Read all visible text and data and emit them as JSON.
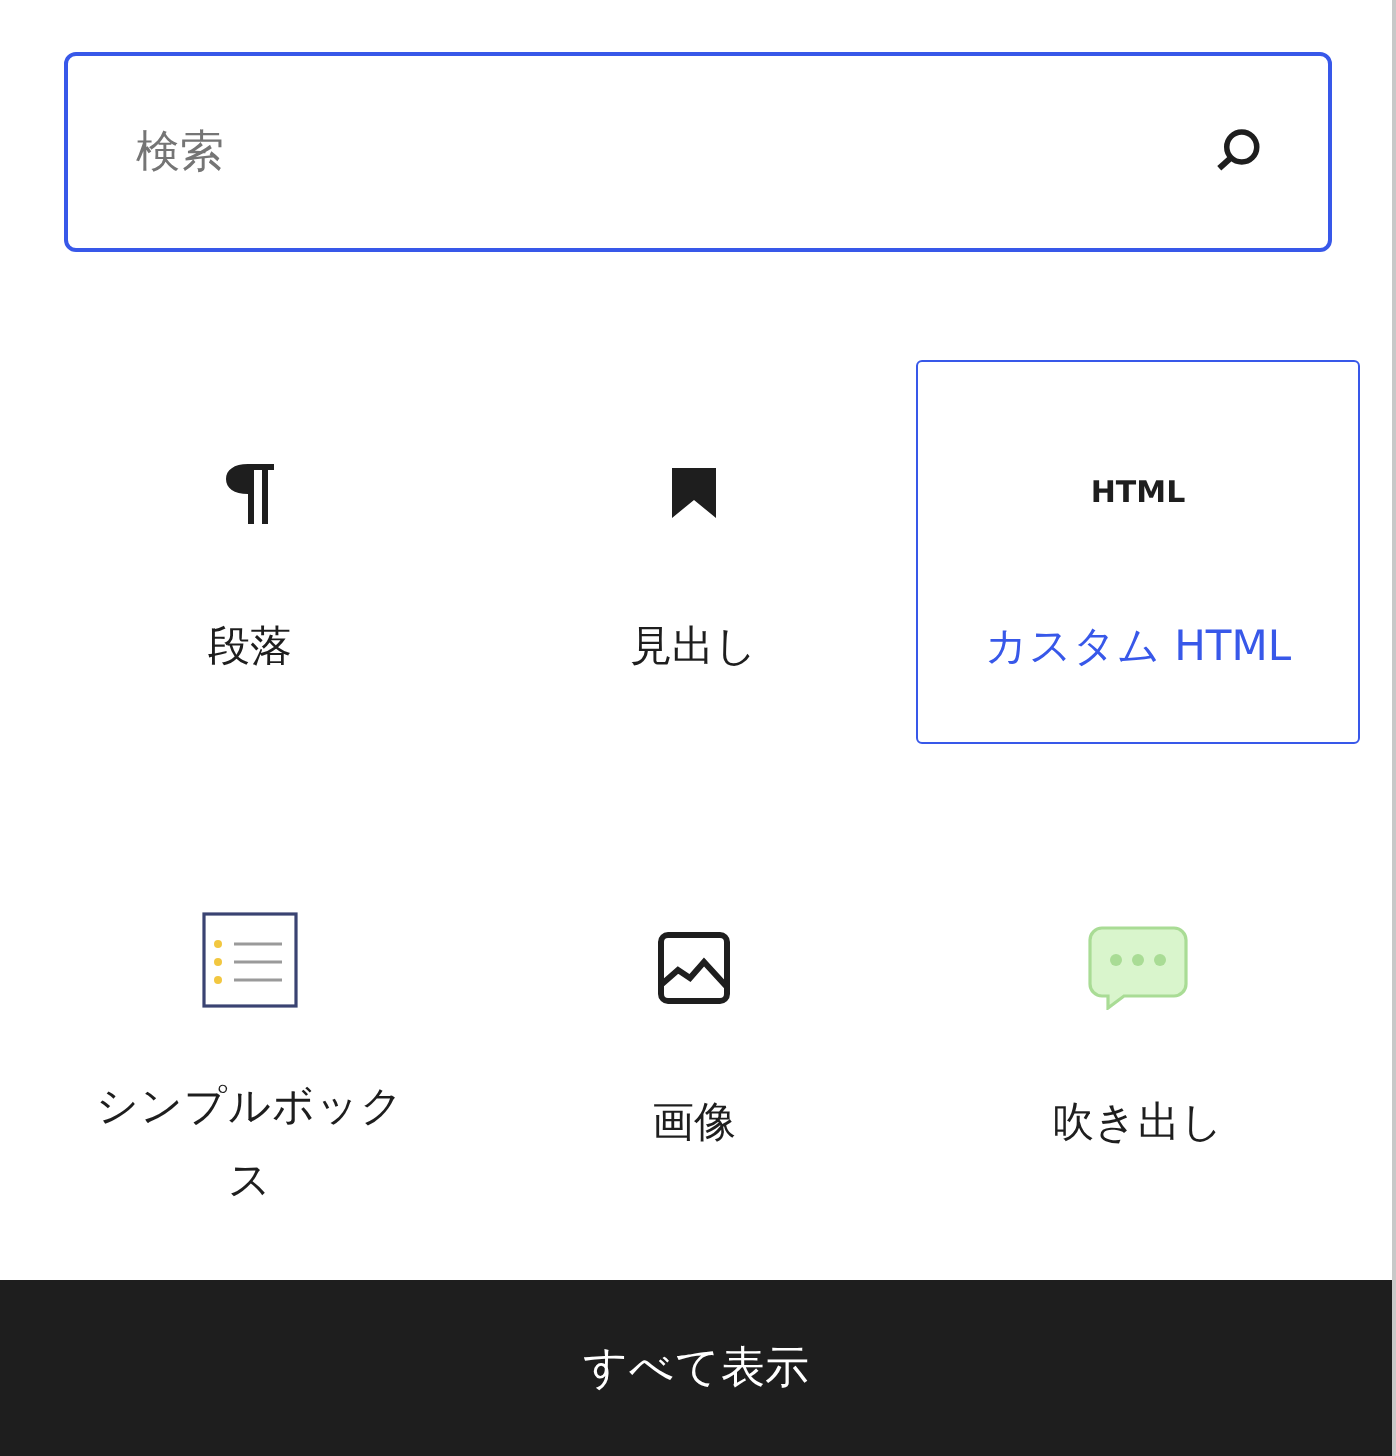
{
  "search": {
    "placeholder": "検索"
  },
  "blocks": [
    {
      "kind": "pilcrow",
      "label": "段落",
      "selected": false
    },
    {
      "kind": "bookmark",
      "label": "見出し",
      "selected": false
    },
    {
      "kind": "html",
      "icon_text": "HTML",
      "label": "カスタム HTML",
      "selected": true
    },
    {
      "kind": "list",
      "label": "シンプルボックス",
      "selected": false
    },
    {
      "kind": "image",
      "label": "画像",
      "selected": false
    },
    {
      "kind": "balloon",
      "label": "吹き出し",
      "selected": false
    }
  ],
  "footer_button": "すべて表示"
}
